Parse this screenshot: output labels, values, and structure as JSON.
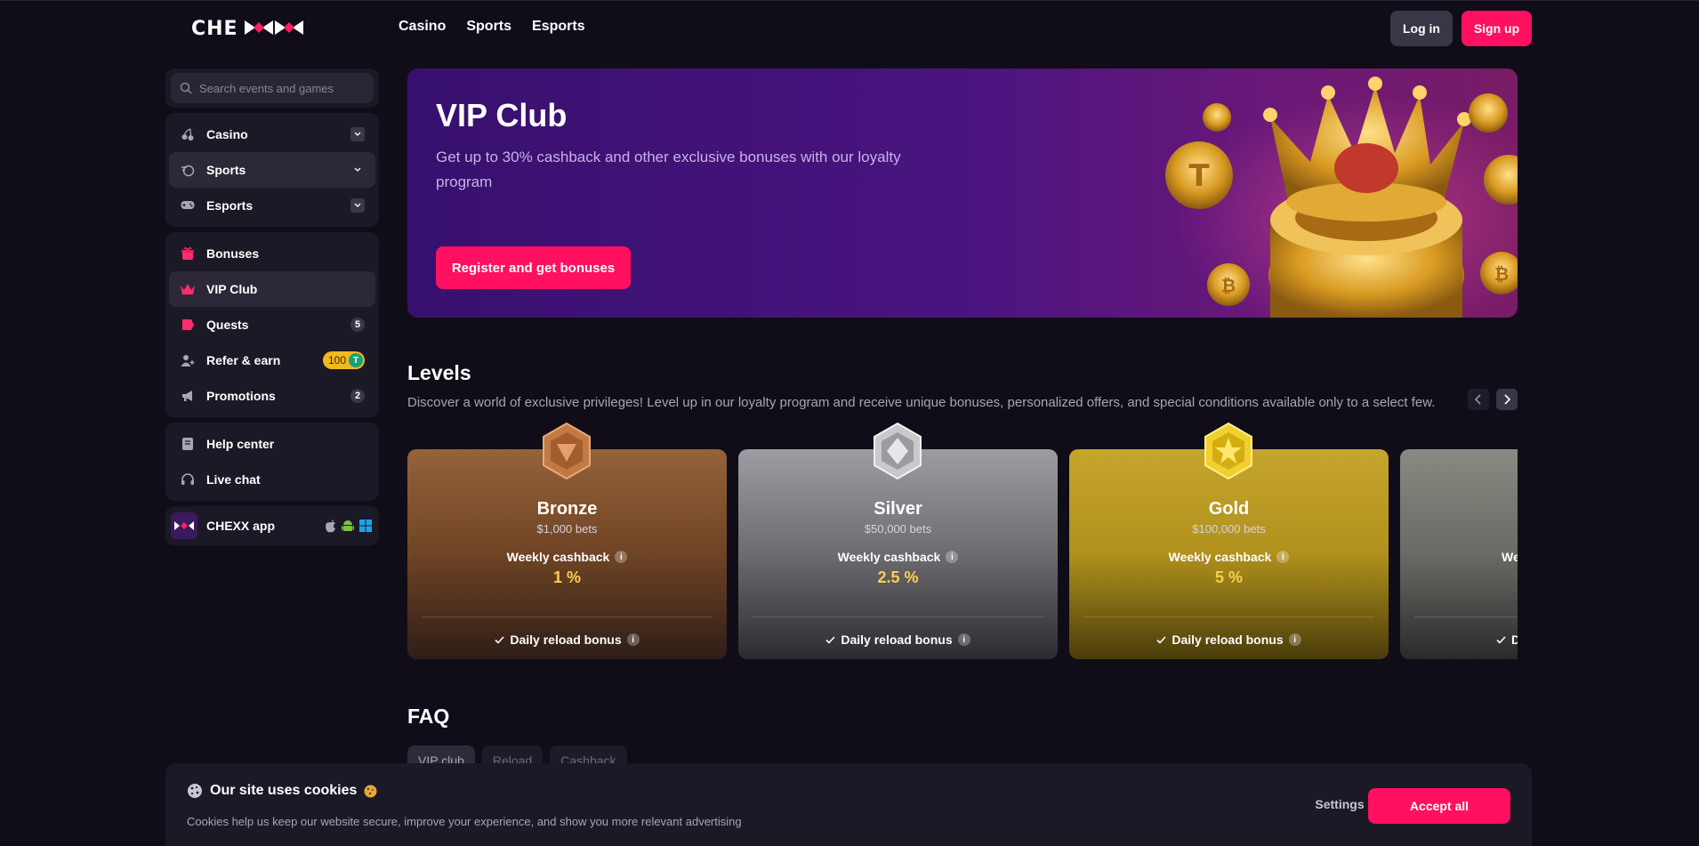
{
  "header": {
    "logo": "CHEXX",
    "nav": [
      "Casino",
      "Sports",
      "Esports"
    ],
    "login_label": "Log in",
    "signup_label": "Sign up"
  },
  "sidebar": {
    "search_placeholder": "Search events and games",
    "group1": [
      {
        "label": "Casino",
        "icon": "cherry-icon"
      },
      {
        "label": "Sports",
        "icon": "sport-icon"
      },
      {
        "label": "Esports",
        "icon": "gamepad-icon"
      }
    ],
    "group2": [
      {
        "label": "Bonuses",
        "icon": "gift-icon"
      },
      {
        "label": "VIP Club",
        "icon": "crown-icon"
      },
      {
        "label": "Quests",
        "icon": "quest-icon",
        "badge": "5"
      },
      {
        "label": "Refer & earn",
        "icon": "user-plus-icon",
        "badge": "100",
        "badge_token": "T"
      },
      {
        "label": "Promotions",
        "icon": "megaphone-icon",
        "badge": "2"
      }
    ],
    "group3": [
      {
        "label": "Help center",
        "icon": "book-icon"
      },
      {
        "label": "Live chat",
        "icon": "headset-icon"
      }
    ],
    "app_label": "CHEXX app"
  },
  "hero": {
    "title": "VIP Club",
    "subtitle": "Get up to 30% cashback and other exclusive bonuses with our loyalty program",
    "button": "Register and get bonuses"
  },
  "levels": {
    "title": "Levels",
    "subtitle": "Discover a world of exclusive privileges! Level up in our loyalty program and receive unique bonuses, personalized offers, and special conditions available only to a select few.",
    "cards": [
      {
        "name": "Bronze",
        "bets": "$1,000 bets",
        "cashback_label": "Weekly cashback",
        "cashback": "1 %",
        "reload": "Daily reload bonus"
      },
      {
        "name": "Silver",
        "bets": "$50,000 bets",
        "cashback_label": "Weekly cashback",
        "cashback": "2.5 %",
        "reload": "Daily reload bonus"
      },
      {
        "name": "Gold",
        "bets": "$100,000 bets",
        "cashback_label": "Weekly cashback",
        "cashback": "5 %",
        "reload": "Daily reload bonus"
      },
      {
        "name": "",
        "bets": "",
        "cashback_label": "We",
        "cashback": "",
        "reload": "D"
      }
    ]
  },
  "faq": {
    "title": "FAQ",
    "tabs": [
      "VIP club",
      "Reload",
      "Cashback"
    ]
  },
  "cookies": {
    "title": "Our site uses cookies",
    "text": "Cookies help us keep our website secure, improve your experience, and show you more relevant advertising",
    "settings": "Settings",
    "accept": "Accept all"
  },
  "colors": {
    "accent": "#ff1060",
    "background": "#100d19",
    "panel": "#1c1926"
  }
}
